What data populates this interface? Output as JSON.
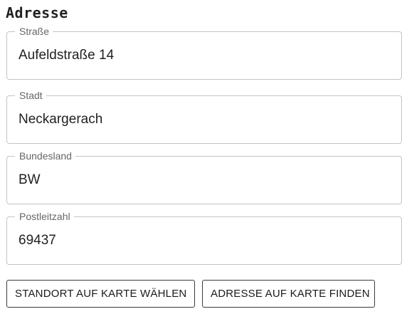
{
  "form": {
    "title": "Adresse",
    "fields": [
      {
        "label": "Straße",
        "value": "Aufeldstraße 14"
      },
      {
        "label": "Stadt",
        "value": "Neckargerach"
      },
      {
        "label": "Bundesland",
        "value": "BW"
      },
      {
        "label": "Postleitzahl",
        "value": "69437"
      }
    ]
  },
  "actions": {
    "pick_location_label": "STANDORT AUF KARTE WÄHLEN",
    "find_address_label": "ADRESSE AUF KARTE FINDEN"
  }
}
